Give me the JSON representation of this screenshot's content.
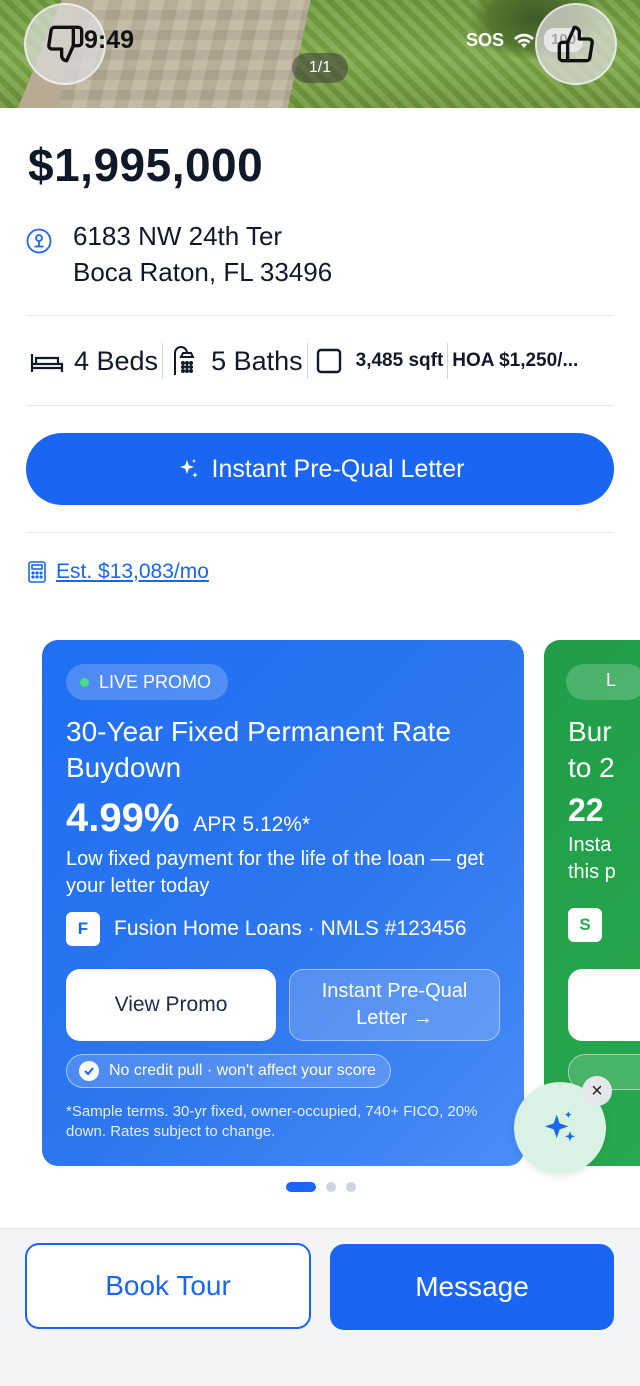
{
  "status_bar": {
    "time": "9:49",
    "sos": "SOS",
    "battery": "100"
  },
  "hero": {
    "photo_counter": "1/1"
  },
  "listing": {
    "price": "$1,995,000",
    "address_line1": "6183 NW 24th Ter",
    "address_line2": "Boca Raton, FL 33496",
    "beds": "4 Beds",
    "baths": "5 Baths",
    "sqft": "3,485 sqft",
    "hoa": "HOA $1,250/..."
  },
  "prequal_button": {
    "label": "Instant Pre-Qual Letter"
  },
  "estimate": {
    "label": "Est. $13,083/mo"
  },
  "promo": {
    "badge": "LIVE PROMO",
    "title": "30-Year Fixed Permanent Rate Buydown",
    "rate": "4.99%",
    "apr": "APR 5.12%*",
    "description": "Low fixed payment for the life of the loan — get your letter today",
    "lender_logo": "F",
    "lender": "Fusion Home Loans · NMLS #123456",
    "view_button": "View Promo",
    "prequal_button": "Instant Pre-Qual Letter →",
    "credit_note": "No credit pull · won't affect your score",
    "disclaimer": "*Sample terms. 30-yr fixed, owner-occupied, 740+ FICO, 20% down. Rates subject to change."
  },
  "promo_next": {
    "badge": "L",
    "title": "Bur",
    "title2": "to 2",
    "rate": "22",
    "desc1": "Insta",
    "desc2": "this p",
    "logo": "S"
  },
  "fab": {
    "close": "×"
  },
  "actions": {
    "book_tour": "Book Tour",
    "message": "Message"
  },
  "colors": {
    "accent": "#1a66f2",
    "promo_blue": "#2d76ee",
    "promo_green": "#28a84f",
    "fab_bg": "#d9f2e3"
  },
  "icons": [
    "thumbs-down-icon",
    "thumbs-up-icon",
    "wifi-icon",
    "location-icon",
    "bed-icon",
    "shower-icon",
    "square-icon",
    "sparkle-icon",
    "calculator-icon",
    "check-badge-icon",
    "close-icon"
  ]
}
